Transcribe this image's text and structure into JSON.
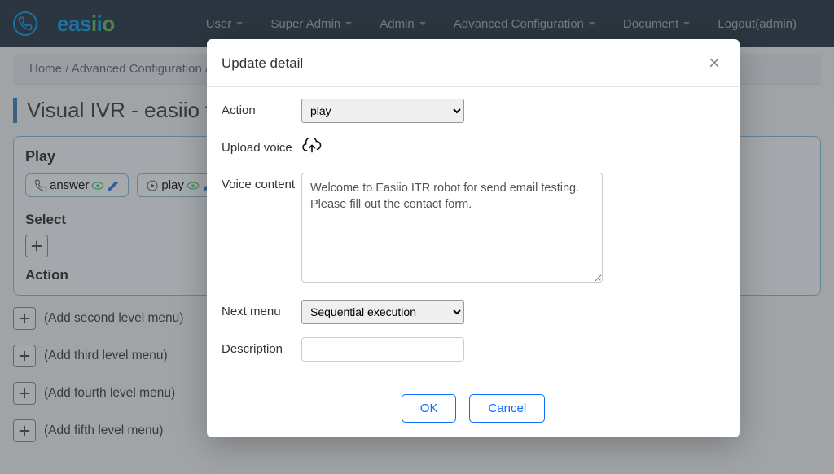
{
  "nav": {
    "menu": [
      "User",
      "Super Admin",
      "Admin",
      "Advanced Configuration",
      "Document"
    ],
    "logout": "Logout(admin)"
  },
  "breadcrumb": {
    "home": "Home",
    "section": "Advanced Configuration"
  },
  "page": {
    "title": "Visual IVR - easiio test"
  },
  "panel": {
    "play_title": "Play",
    "chips": {
      "answer": "answer",
      "play": "play"
    },
    "select_title": "Select",
    "action_title": "Action"
  },
  "levels": {
    "second": "(Add second level menu)",
    "third": "(Add third level menu)",
    "fourth": "(Add fourth level menu)",
    "fifth": "(Add fifth level menu)"
  },
  "modal": {
    "title": "Update detail",
    "labels": {
      "action": "Action",
      "upload": "Upload voice",
      "voice_content": "Voice content",
      "next_menu": "Next menu",
      "description": "Description"
    },
    "action_value": "play",
    "voice_content": "Welcome to Easiio ITR robot for send email testing. Please fill out the contact form.",
    "next_menu_value": "Sequential execution",
    "description_value": "",
    "ok": "OK",
    "cancel": "Cancel"
  }
}
